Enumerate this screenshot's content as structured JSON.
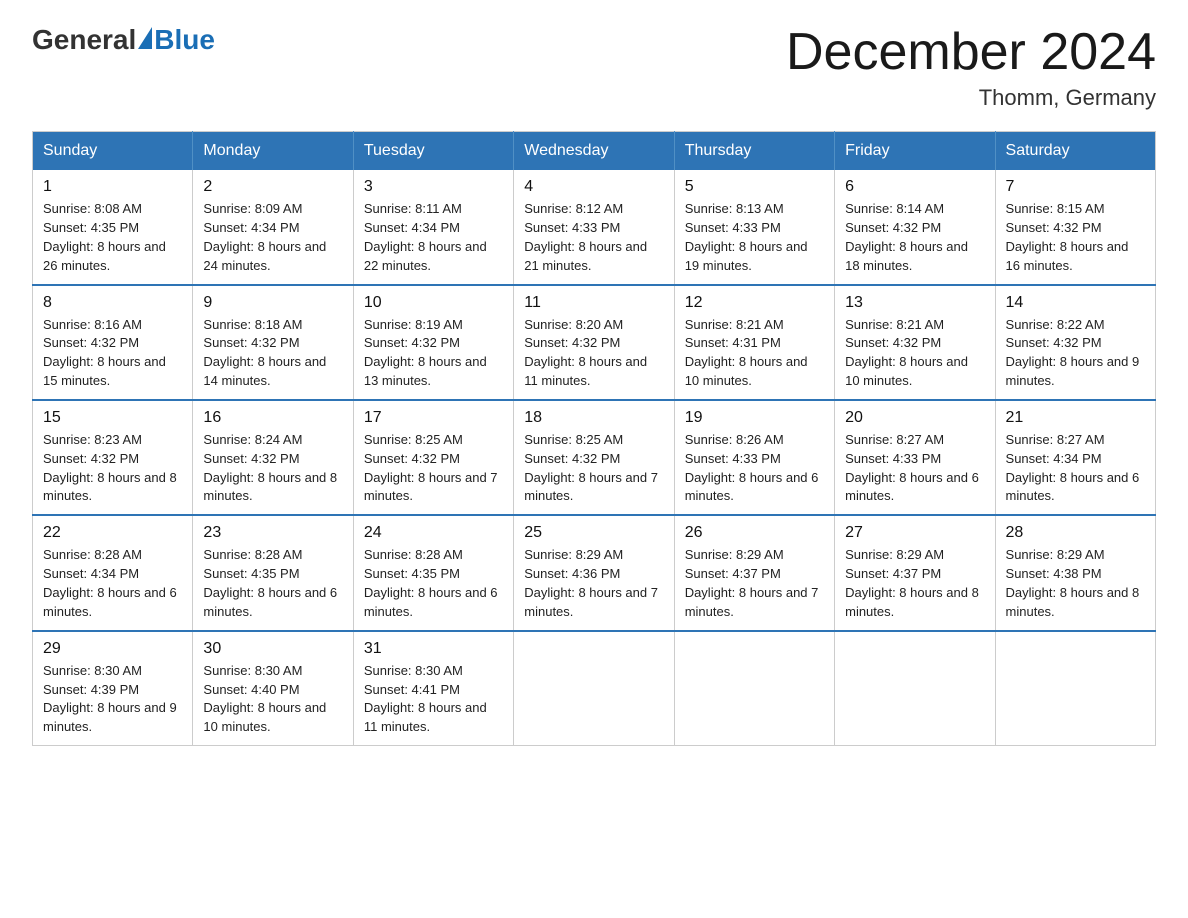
{
  "header": {
    "logo_general": "General",
    "logo_blue": "Blue",
    "month_title": "December 2024",
    "location": "Thomm, Germany"
  },
  "days_of_week": [
    "Sunday",
    "Monday",
    "Tuesday",
    "Wednesday",
    "Thursday",
    "Friday",
    "Saturday"
  ],
  "weeks": [
    [
      {
        "day": "1",
        "sunrise": "8:08 AM",
        "sunset": "4:35 PM",
        "daylight": "8 hours and 26 minutes."
      },
      {
        "day": "2",
        "sunrise": "8:09 AM",
        "sunset": "4:34 PM",
        "daylight": "8 hours and 24 minutes."
      },
      {
        "day": "3",
        "sunrise": "8:11 AM",
        "sunset": "4:34 PM",
        "daylight": "8 hours and 22 minutes."
      },
      {
        "day": "4",
        "sunrise": "8:12 AM",
        "sunset": "4:33 PM",
        "daylight": "8 hours and 21 minutes."
      },
      {
        "day": "5",
        "sunrise": "8:13 AM",
        "sunset": "4:33 PM",
        "daylight": "8 hours and 19 minutes."
      },
      {
        "day": "6",
        "sunrise": "8:14 AM",
        "sunset": "4:32 PM",
        "daylight": "8 hours and 18 minutes."
      },
      {
        "day": "7",
        "sunrise": "8:15 AM",
        "sunset": "4:32 PM",
        "daylight": "8 hours and 16 minutes."
      }
    ],
    [
      {
        "day": "8",
        "sunrise": "8:16 AM",
        "sunset": "4:32 PM",
        "daylight": "8 hours and 15 minutes."
      },
      {
        "day": "9",
        "sunrise": "8:18 AM",
        "sunset": "4:32 PM",
        "daylight": "8 hours and 14 minutes."
      },
      {
        "day": "10",
        "sunrise": "8:19 AM",
        "sunset": "4:32 PM",
        "daylight": "8 hours and 13 minutes."
      },
      {
        "day": "11",
        "sunrise": "8:20 AM",
        "sunset": "4:32 PM",
        "daylight": "8 hours and 11 minutes."
      },
      {
        "day": "12",
        "sunrise": "8:21 AM",
        "sunset": "4:31 PM",
        "daylight": "8 hours and 10 minutes."
      },
      {
        "day": "13",
        "sunrise": "8:21 AM",
        "sunset": "4:32 PM",
        "daylight": "8 hours and 10 minutes."
      },
      {
        "day": "14",
        "sunrise": "8:22 AM",
        "sunset": "4:32 PM",
        "daylight": "8 hours and 9 minutes."
      }
    ],
    [
      {
        "day": "15",
        "sunrise": "8:23 AM",
        "sunset": "4:32 PM",
        "daylight": "8 hours and 8 minutes."
      },
      {
        "day": "16",
        "sunrise": "8:24 AM",
        "sunset": "4:32 PM",
        "daylight": "8 hours and 8 minutes."
      },
      {
        "day": "17",
        "sunrise": "8:25 AM",
        "sunset": "4:32 PM",
        "daylight": "8 hours and 7 minutes."
      },
      {
        "day": "18",
        "sunrise": "8:25 AM",
        "sunset": "4:32 PM",
        "daylight": "8 hours and 7 minutes."
      },
      {
        "day": "19",
        "sunrise": "8:26 AM",
        "sunset": "4:33 PM",
        "daylight": "8 hours and 6 minutes."
      },
      {
        "day": "20",
        "sunrise": "8:27 AM",
        "sunset": "4:33 PM",
        "daylight": "8 hours and 6 minutes."
      },
      {
        "day": "21",
        "sunrise": "8:27 AM",
        "sunset": "4:34 PM",
        "daylight": "8 hours and 6 minutes."
      }
    ],
    [
      {
        "day": "22",
        "sunrise": "8:28 AM",
        "sunset": "4:34 PM",
        "daylight": "8 hours and 6 minutes."
      },
      {
        "day": "23",
        "sunrise": "8:28 AM",
        "sunset": "4:35 PM",
        "daylight": "8 hours and 6 minutes."
      },
      {
        "day": "24",
        "sunrise": "8:28 AM",
        "sunset": "4:35 PM",
        "daylight": "8 hours and 6 minutes."
      },
      {
        "day": "25",
        "sunrise": "8:29 AM",
        "sunset": "4:36 PM",
        "daylight": "8 hours and 7 minutes."
      },
      {
        "day": "26",
        "sunrise": "8:29 AM",
        "sunset": "4:37 PM",
        "daylight": "8 hours and 7 minutes."
      },
      {
        "day": "27",
        "sunrise": "8:29 AM",
        "sunset": "4:37 PM",
        "daylight": "8 hours and 8 minutes."
      },
      {
        "day": "28",
        "sunrise": "8:29 AM",
        "sunset": "4:38 PM",
        "daylight": "8 hours and 8 minutes."
      }
    ],
    [
      {
        "day": "29",
        "sunrise": "8:30 AM",
        "sunset": "4:39 PM",
        "daylight": "8 hours and 9 minutes."
      },
      {
        "day": "30",
        "sunrise": "8:30 AM",
        "sunset": "4:40 PM",
        "daylight": "8 hours and 10 minutes."
      },
      {
        "day": "31",
        "sunrise": "8:30 AM",
        "sunset": "4:41 PM",
        "daylight": "8 hours and 11 minutes."
      },
      null,
      null,
      null,
      null
    ]
  ]
}
